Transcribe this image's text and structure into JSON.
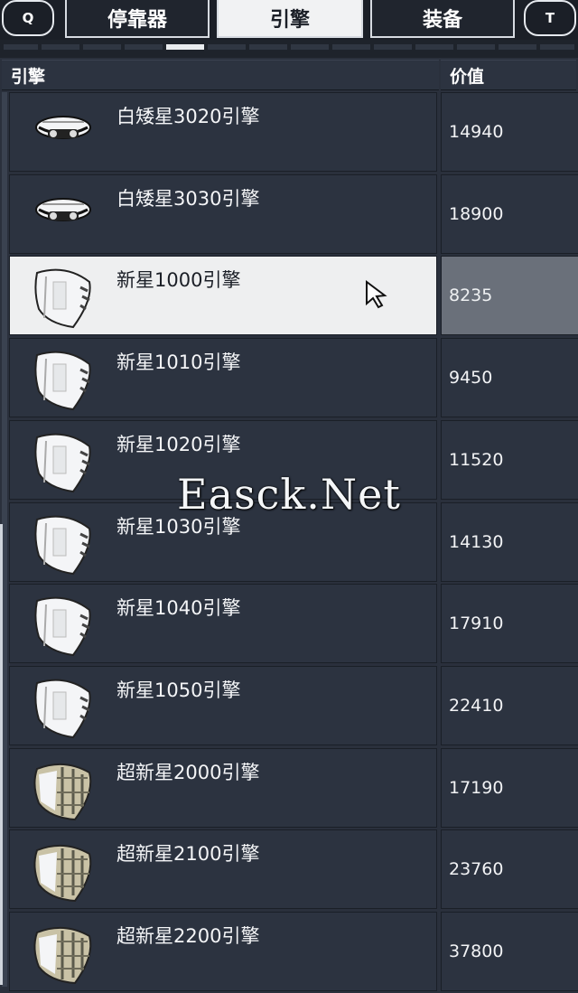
{
  "hotkeys": {
    "left": "Q",
    "right": "T"
  },
  "tabs": [
    {
      "label": "停靠器"
    },
    {
      "label": "引擎"
    },
    {
      "label": "装备"
    }
  ],
  "header": {
    "name": "引擎",
    "value": "价值"
  },
  "items": [
    {
      "name": "白矮星3020引擎",
      "value": "14940",
      "icon": "white-dwarf-engine-icon"
    },
    {
      "name": "白矮星3030引擎",
      "value": "18900",
      "icon": "white-dwarf-engine-icon"
    },
    {
      "name": "新星1000引擎",
      "value": "8235",
      "icon": "nova-engine-icon"
    },
    {
      "name": "新星1010引擎",
      "value": "9450",
      "icon": "nova-engine-icon"
    },
    {
      "name": "新星1020引擎",
      "value": "11520",
      "icon": "nova-engine-icon"
    },
    {
      "name": "新星1030引擎",
      "value": "14130",
      "icon": "nova-engine-icon"
    },
    {
      "name": "新星1040引擎",
      "value": "17910",
      "icon": "nova-engine-icon"
    },
    {
      "name": "新星1050引擎",
      "value": "22410",
      "icon": "nova-engine-icon"
    },
    {
      "name": "超新星2000引擎",
      "value": "17190",
      "icon": "supernova-engine-icon"
    },
    {
      "name": "超新星2100引擎",
      "value": "23760",
      "icon": "supernova-engine-icon"
    },
    {
      "name": "超新星2200引擎",
      "value": "37800",
      "icon": "supernova-engine-icon"
    }
  ],
  "selected_index": 2,
  "watermark": "Easck.Net",
  "colors": {
    "background": "#2a303c",
    "selected_row": "#eeeff0",
    "selected_value": "#6a707a"
  }
}
